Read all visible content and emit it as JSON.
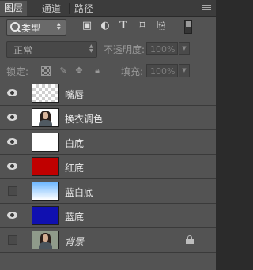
{
  "tabs": [
    {
      "label": "图层",
      "active": true
    },
    {
      "label": "通道",
      "active": false
    },
    {
      "label": "路径",
      "active": false
    }
  ],
  "filter": {
    "kind_label": "类型",
    "icons": [
      "image-filter-icon",
      "adjustment-filter-icon",
      "type-filter-icon",
      "shape-filter-icon",
      "smart-object-filter-icon"
    ],
    "toggle_icon": "filter-toggle-icon"
  },
  "blend": {
    "mode": "正常",
    "opacity_label": "不透明度:",
    "opacity_value": "100%"
  },
  "lock": {
    "label": "锁定:",
    "icons": [
      "lock-transparent-pixels-icon",
      "lock-image-pixels-icon",
      "lock-position-icon",
      "lock-all-icon"
    ],
    "fill_label": "填充:",
    "fill_value": "100%"
  },
  "layers": [
    {
      "name": "嘴唇",
      "visible": true,
      "thumbnail": "transparent",
      "locked": false
    },
    {
      "name": "换衣调色",
      "visible": true,
      "thumbnail": "portrait",
      "locked": false
    },
    {
      "name": "白底",
      "visible": true,
      "thumbnail": "#ffffff",
      "locked": false
    },
    {
      "name": "红底",
      "visible": true,
      "thumbnail": "#c00000",
      "locked": false
    },
    {
      "name": "蓝白底",
      "visible": false,
      "thumbnail": "gradient-lightblue-white",
      "locked": false
    },
    {
      "name": "蓝底",
      "visible": true,
      "thumbnail": "#1010b0",
      "locked": false
    },
    {
      "name": "背景",
      "visible": false,
      "thumbnail": "portrait-photo",
      "locked": true
    }
  ],
  "colors": {
    "panel_bg": "#535353",
    "red_fill": "#c00000",
    "blue_fill": "#1010b0",
    "light_blue_top": "#6fb8ff"
  }
}
